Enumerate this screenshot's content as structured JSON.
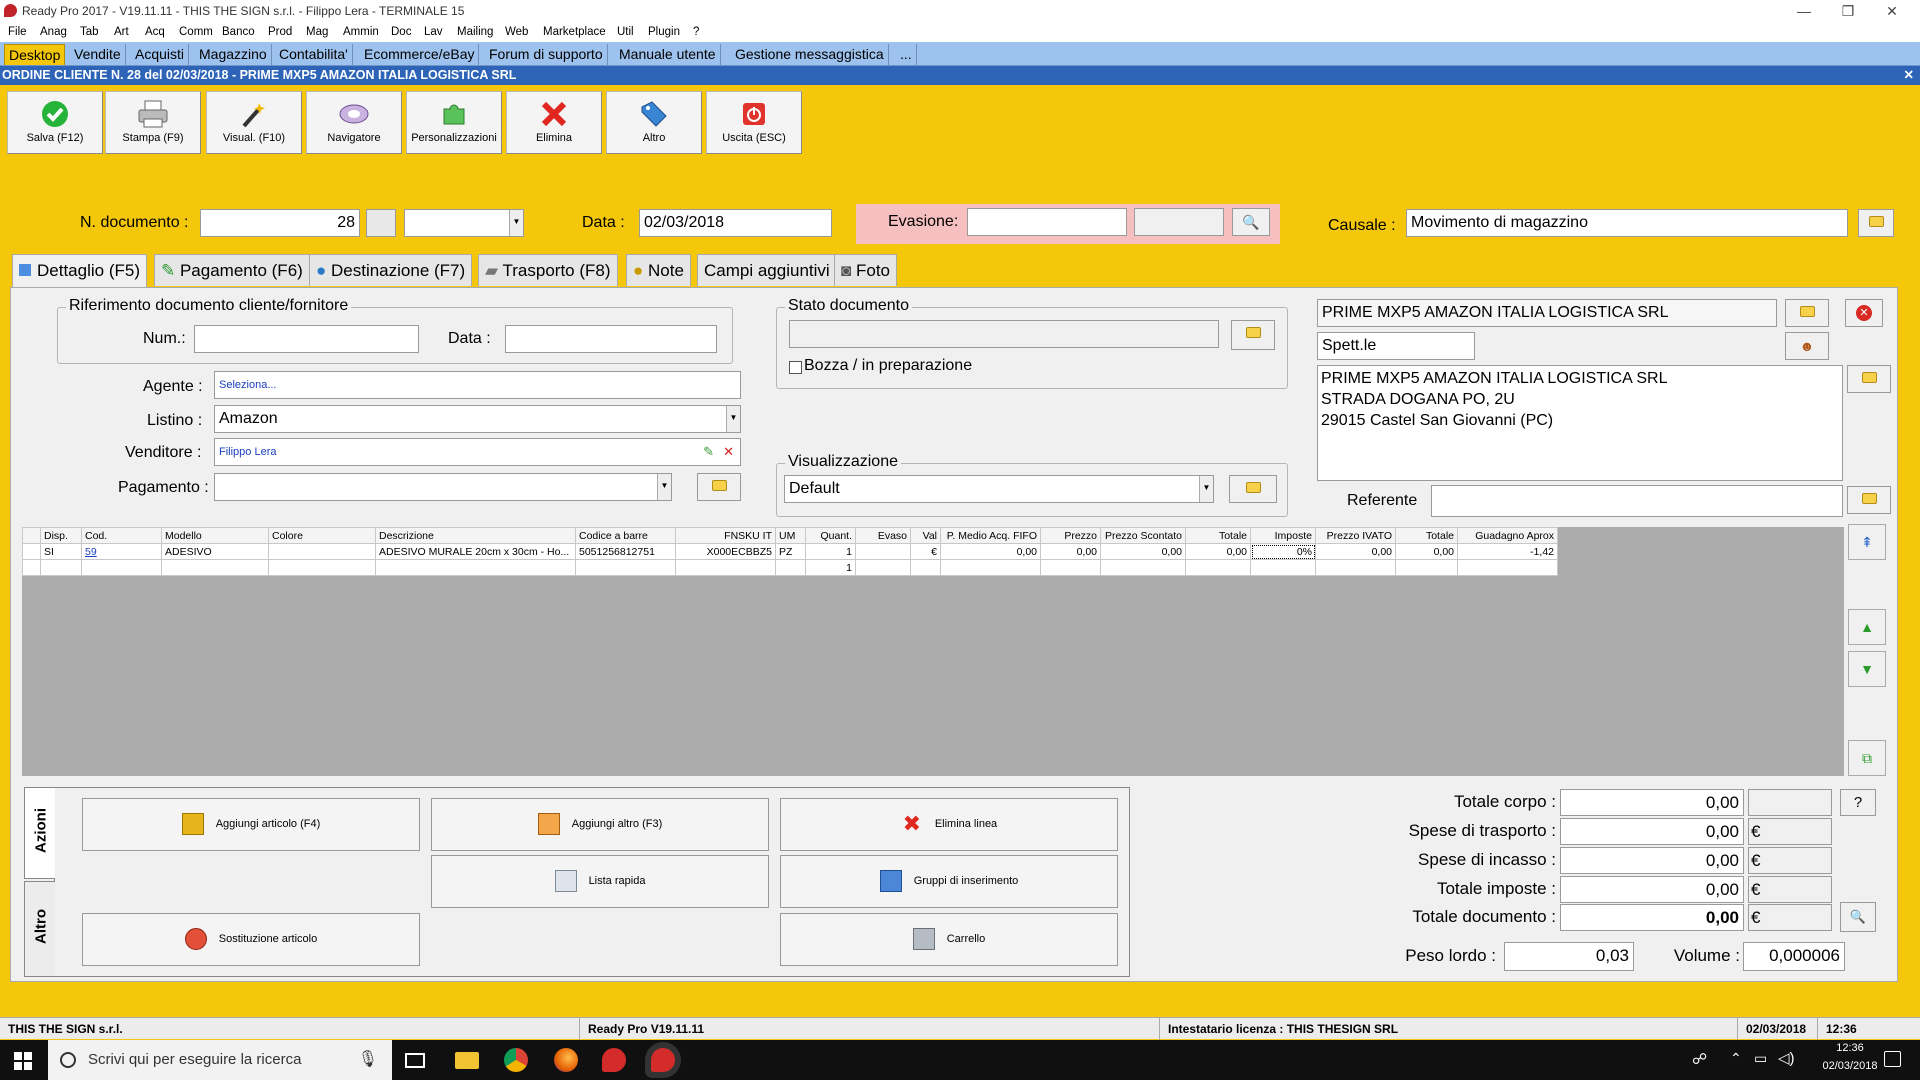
{
  "window": {
    "title": "Ready Pro 2017 - V19.11.11 - THIS THE SIGN s.r.l. - Filippo Lera - TERMINALE 15"
  },
  "menu": [
    "File",
    "Anag",
    "Tab",
    "Art",
    "Acq",
    "Comm",
    "Banco",
    "Prod",
    "Mag",
    "Ammin",
    "Doc",
    "Lav",
    "Mailing",
    "Web",
    "Marketplace",
    "Util",
    "Plugin",
    "?"
  ],
  "main_tabs": [
    "Desktop",
    "Vendite",
    "Acquisti",
    "Magazzino",
    "Contabilita'",
    "Ecommerce/eBay",
    "Forum di supporto",
    "Manuale utente",
    "Gestione messaggistica",
    "..."
  ],
  "doc_header": "ORDINE CLIENTE N. 28 del 02/03/2018 - PRIME MXP5 AMAZON ITALIA LOGISTICA SRL",
  "toolbar": [
    "Salva (F12)",
    "Stampa (F9)",
    "Visual. (F10)",
    "Navigatore",
    "Personalizzazioni",
    "Elimina",
    "Altro",
    "Uscita (ESC)"
  ],
  "header": {
    "ndoc_label": "N. documento :",
    "ndoc_value": "28",
    "data_label": "Data :",
    "data_value": "02/03/2018",
    "evasione_label": "Evasione:",
    "causale_label": "Causale :",
    "causale_value": "Movimento di magazzino"
  },
  "panel_tabs": [
    "Dettaglio (F5)",
    "Pagamento (F6)",
    "Destinazione (F7)",
    "Trasporto (F8)",
    "Note",
    "Campi aggiuntivi",
    "Foto"
  ],
  "rif": {
    "title": "Riferimento documento cliente/fornitore",
    "num_label": "Num.:",
    "data_label": "Data :"
  },
  "fields": {
    "agente_label": "Agente :",
    "agente_value": "Seleziona...",
    "listino_label": "Listino :",
    "listino_value": "Amazon",
    "venditore_label": "Venditore :",
    "venditore_value": "Filippo Lera",
    "pagamento_label": "Pagamento :"
  },
  "stato": {
    "title": "Stato documento",
    "bozza": "Bozza / in preparazione"
  },
  "visual": {
    "title": "Visualizzazione",
    "value": "Default"
  },
  "customer": {
    "name": "PRIME MXP5 AMAZON ITALIA LOGISTICA SRL",
    "salutation": "Spett.le",
    "address": [
      "PRIME MXP5 AMAZON ITALIA LOGISTICA SRL",
      "STRADA DOGANA PO, 2U",
      "29015 Castel San Giovanni (PC)"
    ],
    "referente_label": "Referente"
  },
  "grid": {
    "columns": [
      "Disp.",
      "Cod.",
      "Modello",
      "Colore",
      "Descrizione",
      "Codice a barre",
      "FNSKU IT",
      "UM",
      "Quant.",
      "Evaso",
      "Val",
      "P. Medio Acq. FIFO",
      "Prezzo",
      "Prezzo Scontato",
      "Totale",
      "Imposte",
      "Prezzo IVATO",
      "Totale",
      "Guadagno Aprox"
    ],
    "rows": [
      [
        "SI",
        "59",
        "ADESIVO",
        "",
        "ADESIVO MURALE 20cm x 30cm - Ho...",
        "5051256812751",
        "X000ECBBZ5",
        "PZ",
        "1",
        "",
        "€",
        "0,00",
        "0,00",
        "0,00",
        "0,00",
        "0%",
        "0,00",
        "0,00",
        "-1,42"
      ],
      [
        "",
        "",
        "",
        "",
        "",
        "",
        "",
        "",
        "1",
        "",
        "",
        "",
        "",
        "",
        "",
        "",
        "",
        "",
        ""
      ]
    ]
  },
  "side_tabs": [
    "Azioni",
    "Altro"
  ],
  "actions": {
    "add_article": "Aggiungi articolo (F4)",
    "add_other": "Aggiungi altro (F3)",
    "delete_line": "Elimina linea",
    "quick_list": "Lista rapida",
    "insert_groups": "Gruppi di inserimento",
    "replace_article": "Sostituzione articolo",
    "cart": "Carrello"
  },
  "totals": {
    "corpo_label": "Totale corpo :",
    "corpo": "0,00",
    "trasporto_label": "Spese di trasporto :",
    "trasporto": "0,00",
    "incasso_label": "Spese di incasso :",
    "incasso": "0,00",
    "imposte_label": "Totale imposte :",
    "imposte": "0,00",
    "documento_label": "Totale documento :",
    "documento": "0,00",
    "currency": "€",
    "help": "?",
    "peso_label": "Peso lordo :",
    "peso": "0,03",
    "volume_label": "Volume :",
    "volume": "0,000006"
  },
  "status": {
    "company": "THIS THE SIGN s.r.l.",
    "version": "Ready Pro V19.11.11",
    "license": "Intestatario licenza : THIS THESIGN SRL",
    "date": "02/03/2018",
    "time": "12:36"
  },
  "taskbar": {
    "search_placeholder": "Scrivi qui per eseguire la ricerca",
    "clock_time": "12:36",
    "clock_date": "02/03/2018"
  },
  "colors": {
    "app_bg": "#f4c70a",
    "tab_bar": "#9ec2ee",
    "doc_header": "#2d64b8",
    "evasione_bg": "#f6c0c0"
  }
}
